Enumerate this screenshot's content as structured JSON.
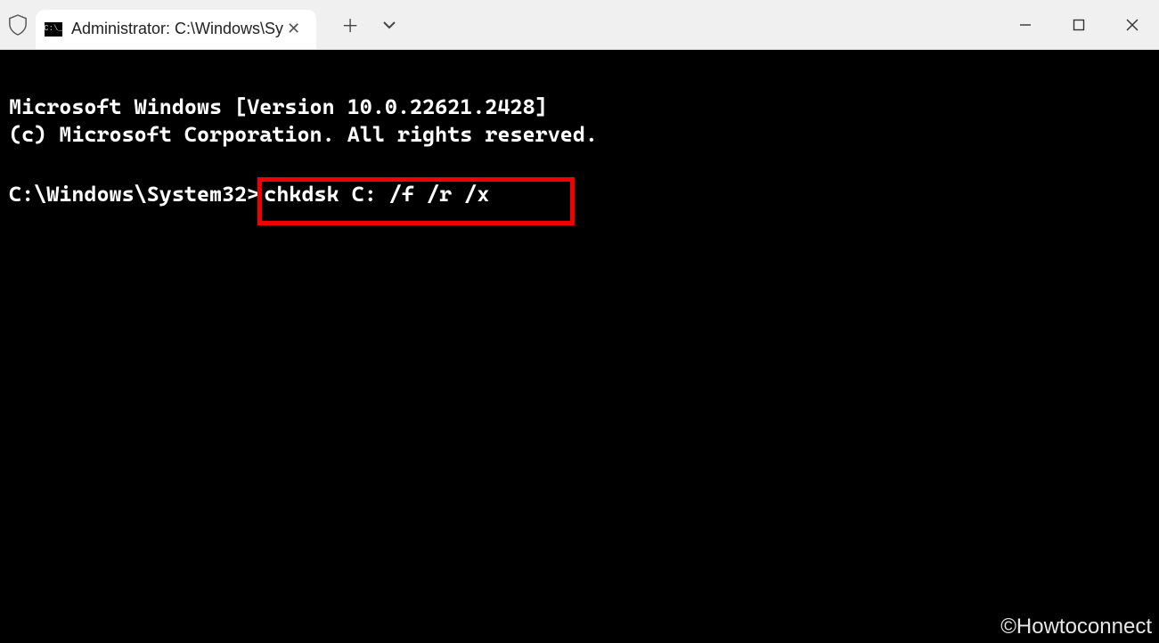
{
  "tab": {
    "title": "Administrator: C:\\Windows\\Sy",
    "close_label": "✕"
  },
  "tabbar": {
    "new_tab_label": "＋",
    "dropdown_label": "⌄"
  },
  "window": {
    "minimize": "—",
    "maximize": "□",
    "close": "✕"
  },
  "terminal": {
    "line1": "Microsoft Windows [Version 10.0.22621.2428]",
    "line2": "(c) Microsoft Corporation. All rights reserved.",
    "prompt": "C:\\Windows\\System32>",
    "command": "chkdsk C: /f /r /x"
  },
  "watermark": "©Howtoconnect",
  "highlight_color": "#f20000"
}
